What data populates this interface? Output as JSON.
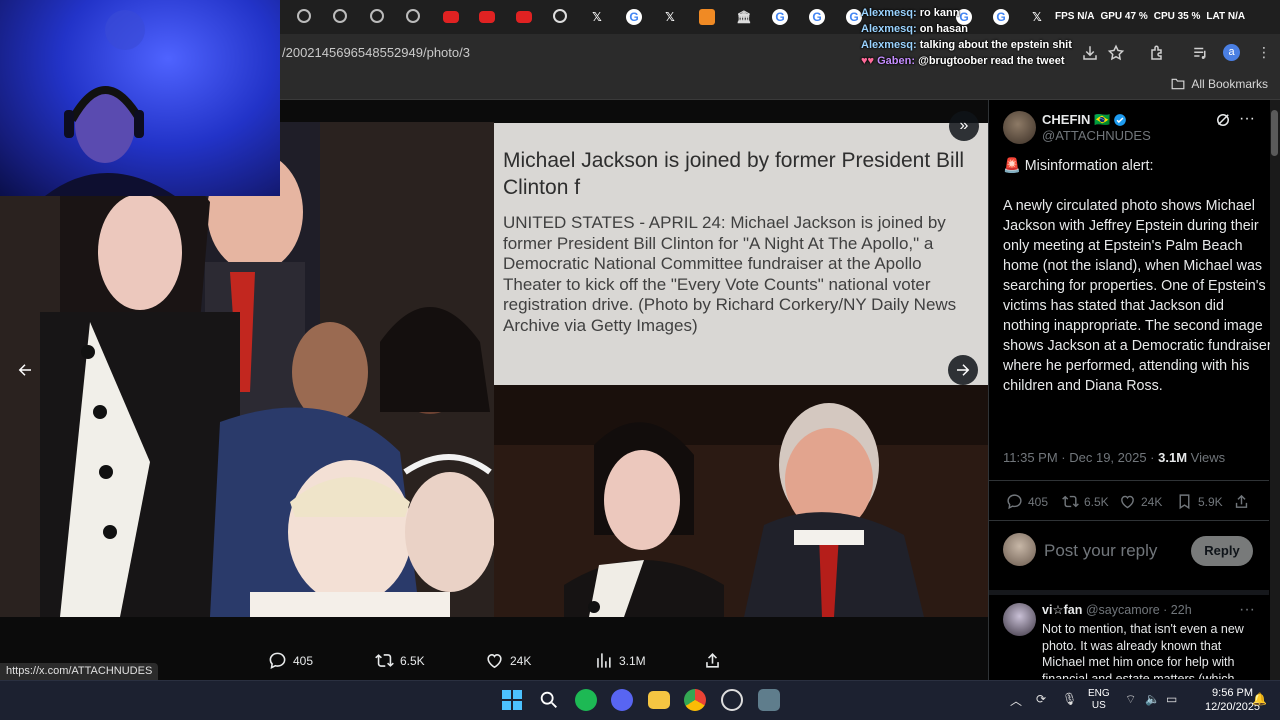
{
  "browser": {
    "url": "/2002145696548552949/photo/3",
    "all_bookmarks": "All Bookmarks",
    "profile_initial": "a"
  },
  "stream_overlay": {
    "stats": [
      {
        "label": "FPS",
        "value": "N/A"
      },
      {
        "label": "GPU",
        "value": "47 %"
      },
      {
        "label": "CPU",
        "value": "35 %"
      },
      {
        "label": "LAT",
        "value": "N/A"
      }
    ],
    "chat": [
      {
        "user": "Alexmesq:",
        "message": "ro kann"
      },
      {
        "user": "Alexmesq:",
        "message": "on hasan"
      },
      {
        "user": "Alexmesq:",
        "message": "talking about the epstein shit"
      },
      {
        "user": "Gaben:",
        "message": "@brugtoober read the tweet"
      }
    ]
  },
  "media": {
    "caption_title": "Michael Jackson is joined by former President Bill Clinton f",
    "caption_body": "UNITED STATES - APRIL 24: Michael Jackson is joined by former President Bill Clinton for \"A Night At The Apollo,\" a Democratic National Committee fundraiser at the Apollo Theater to kick off the \"Every Vote Counts\" national voter registration drive. (Photo by Richard Corkery/NY Daily News Archive via Getty Images)",
    "actions": {
      "replies": "405",
      "reposts": "6.5K",
      "likes": "24K",
      "views": "3.1M"
    }
  },
  "status_url": "https://x.com/ATTACHNUDES",
  "tweet": {
    "author_name": "CHEFIN 🇧🇷",
    "author_handle": "@ATTACHNUDES",
    "alert": "🚨 Misinformation alert:",
    "body": "A newly circulated photo shows Michael Jackson with Jeffrey Epstein during their only meeting at Epstein's Palm Beach home (not the island), when Michael was searching for properties. One of Epstein's victims has stated that Jackson did nothing inappropriate. The second image shows Jackson at a Democratic fundraiser where he performed, attending with his children and Diana Ross.",
    "time": "11:35 PM · Dec 19, 2025 · ",
    "views_count": "3.1M",
    "views_label": " Views",
    "replies": "405",
    "reposts": "6.5K",
    "likes": "24K",
    "bookmarks": "5.9K",
    "reply_placeholder": "Post your reply",
    "reply_button": "Reply"
  },
  "reply": {
    "name": "vi☆fan",
    "meta": " @saycamore · 22h",
    "text": "Not to mention, that isn't even a new photo. It was already known that Michael met him once for help with financial and estate matters (which"
  },
  "taskbar": {
    "lang_top": "ENG",
    "lang_bottom": "US",
    "time": "9:56 PM",
    "date": "12/20/2025"
  },
  "colors": {
    "accent": "#1d9bf0",
    "verified": "#1d9bf0",
    "reply_button_bg": "#787a7a"
  }
}
